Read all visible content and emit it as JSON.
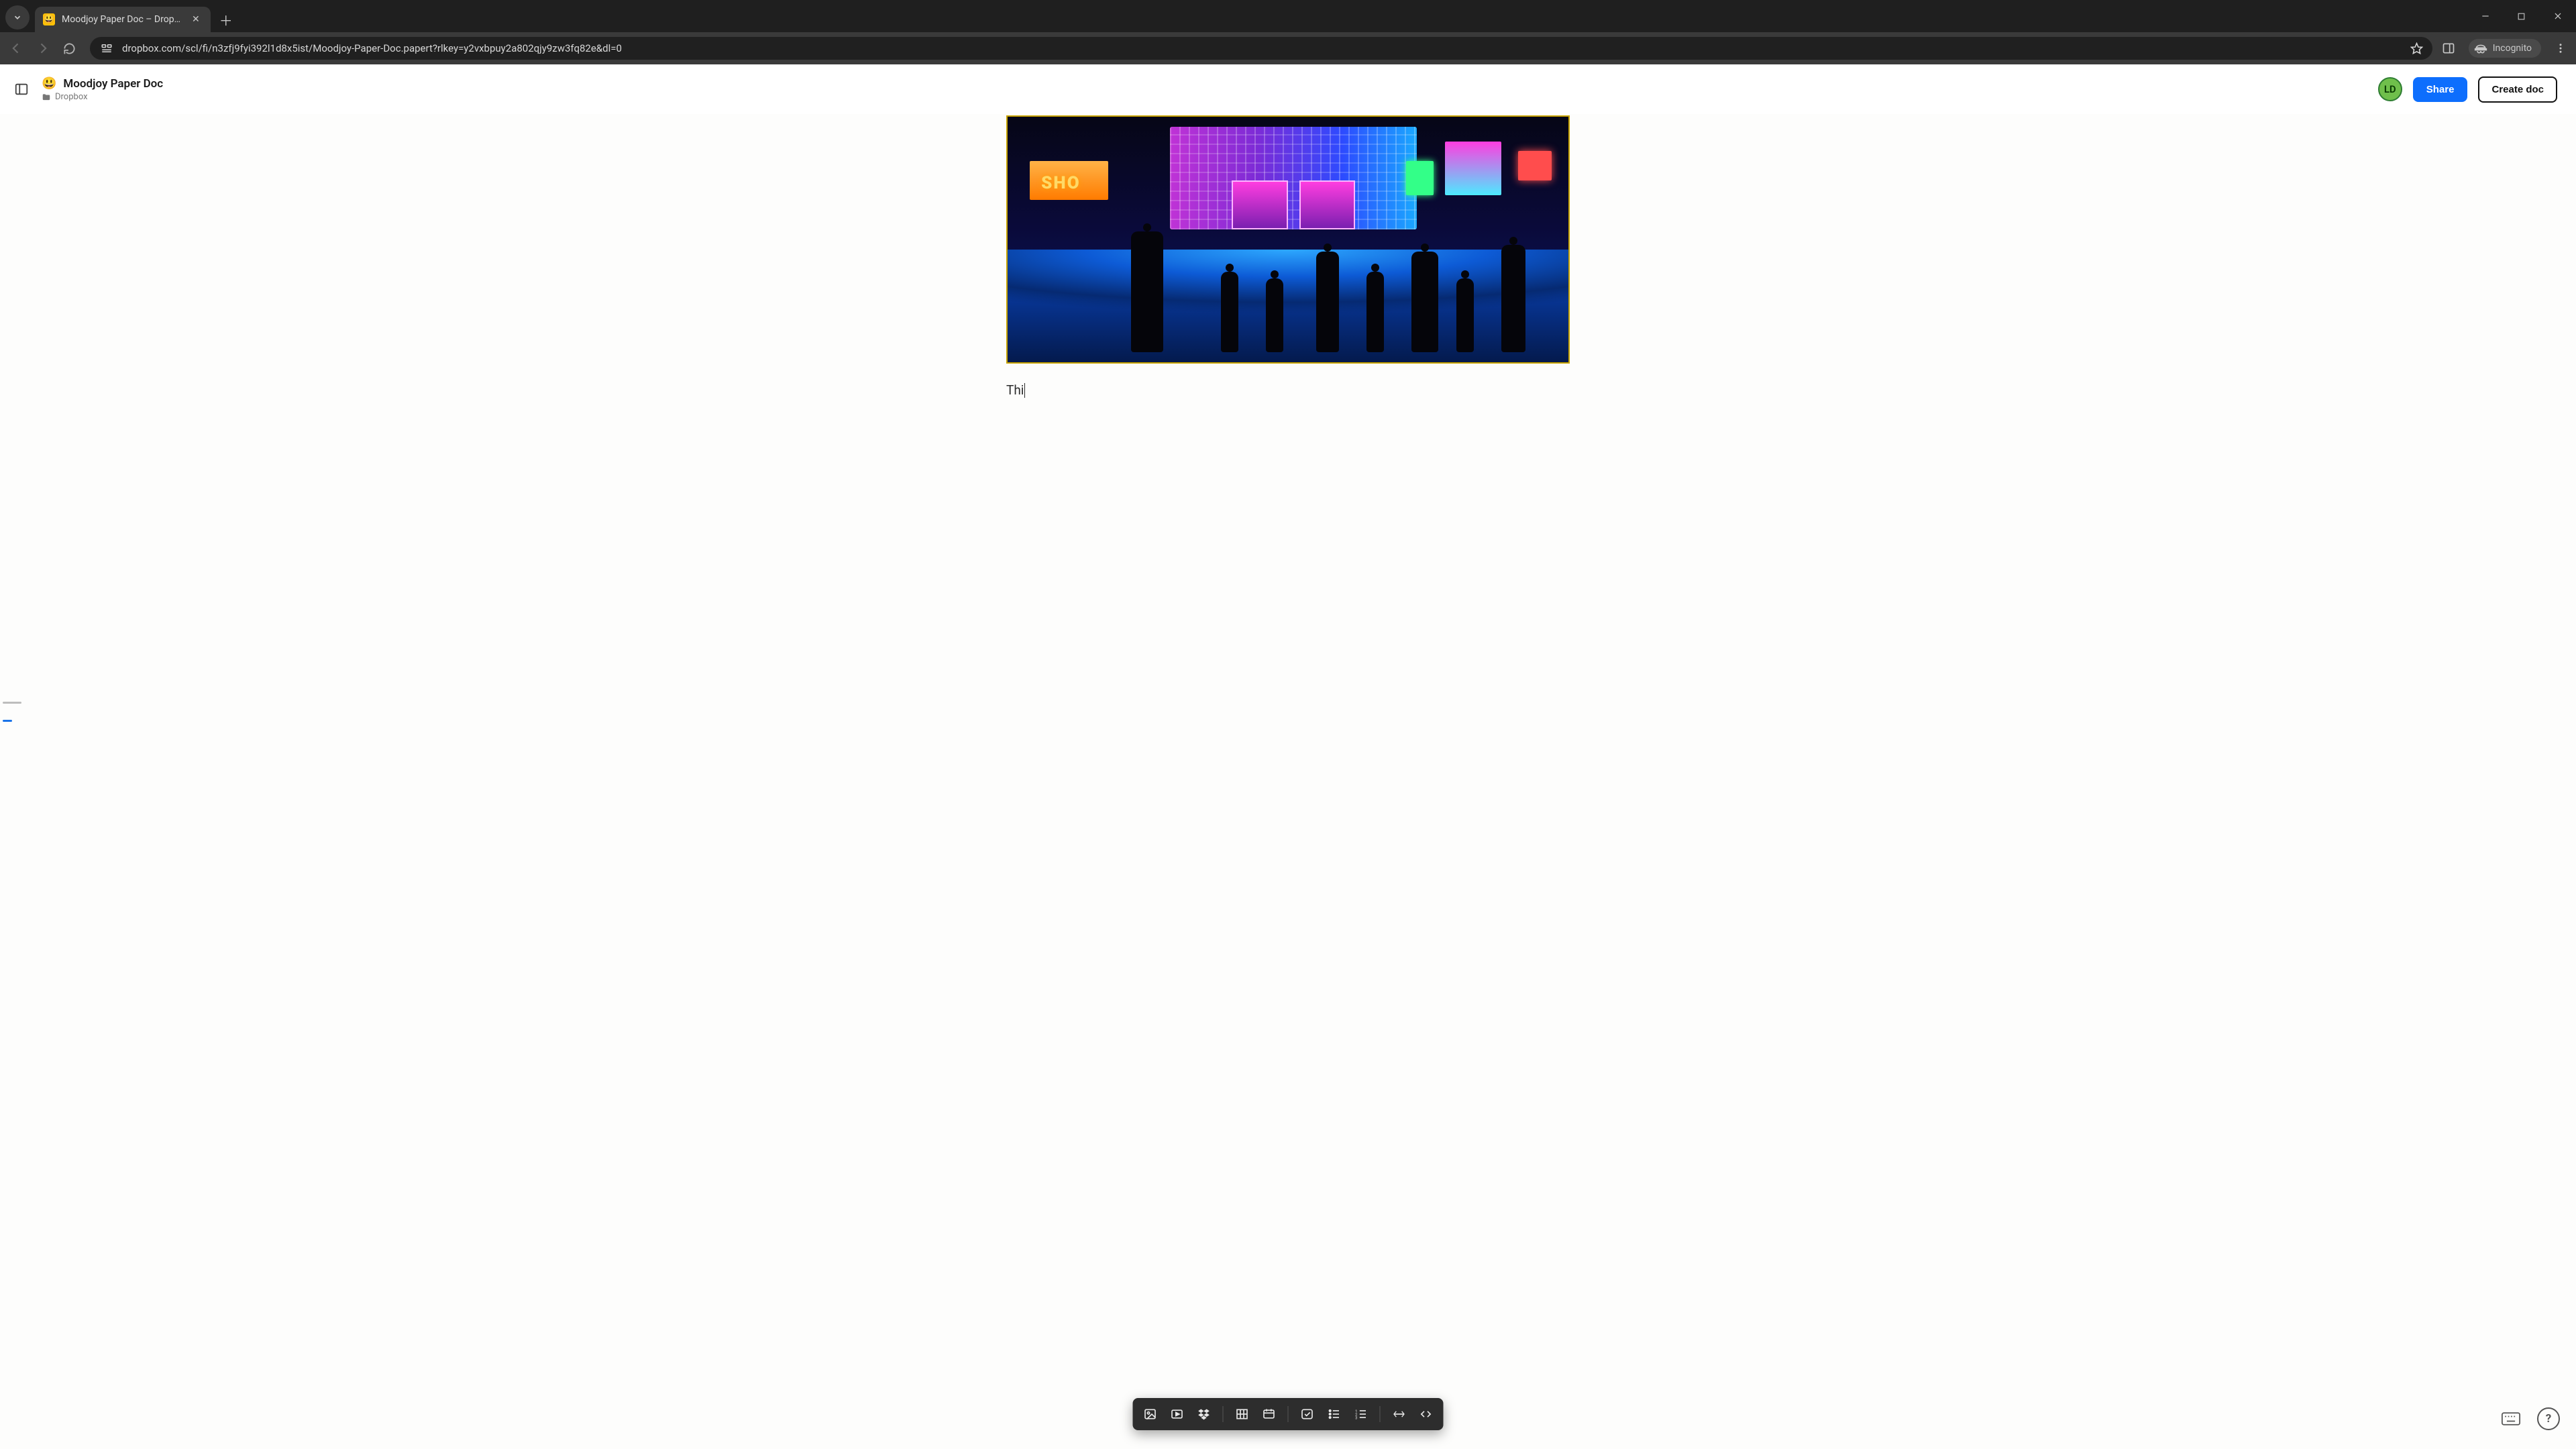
{
  "browser": {
    "tab_title": "Moodjoy Paper Doc – Dropbox",
    "url": "dropbox.com/scl/fi/n3zfj9fyi392l1d8x5ist/Moodjoy-Paper-Doc.papert?rlkey=y2vxbpuy2a802qjy9zw3fq82e&dl=0",
    "incognito_label": "Incognito"
  },
  "header": {
    "doc_emoji": "😃",
    "doc_title": "Moodjoy Paper Doc",
    "breadcrumb_root": "Dropbox",
    "avatar_initials": "LD",
    "share_label": "Share",
    "create_doc_label": "Create doc"
  },
  "document": {
    "embedded_image_alt": "Night street scene with neon lights and crowd",
    "shop_sign_text": "SHO",
    "body_text": "Thi"
  },
  "insert_toolbar": {
    "items": [
      {
        "name": "insert-image-icon"
      },
      {
        "name": "insert-video-icon"
      },
      {
        "name": "insert-dropbox-file-icon"
      },
      {
        "name": "insert-table-icon"
      },
      {
        "name": "insert-timeline-icon"
      },
      {
        "name": "insert-todo-icon"
      },
      {
        "name": "insert-bulleted-list-icon"
      },
      {
        "name": "insert-numbered-list-icon"
      },
      {
        "name": "insert-divider-icon"
      },
      {
        "name": "insert-code-block-icon"
      }
    ]
  },
  "corner": {
    "keyboard_label": "Keyboard shortcuts",
    "help_label": "?"
  },
  "colors": {
    "share_blue": "#0d6efd",
    "avatar_green": "#6fbf4b",
    "image_border": "#c7a300"
  }
}
